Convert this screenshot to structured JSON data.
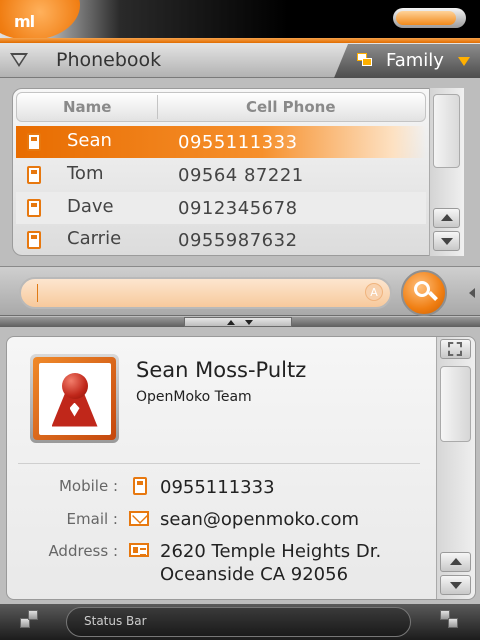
{
  "app": {
    "logo_text": "ml",
    "title": "Phonebook",
    "battery_level": 0.9
  },
  "header": {
    "group_label": "Family"
  },
  "list": {
    "columns": [
      "Name",
      "Cell Phone"
    ],
    "rows": [
      {
        "name": "Sean",
        "phone": "0955111333",
        "selected": true
      },
      {
        "name": "Tom",
        "phone": "09564 87221",
        "selected": false
      },
      {
        "name": "Dave",
        "phone": "0912345678",
        "selected": false
      },
      {
        "name": "Carrie",
        "phone": "0955987632",
        "selected": false
      }
    ]
  },
  "search": {
    "value": "",
    "keyboard_icon_text": "A"
  },
  "detail": {
    "name": "Sean Moss-Pultz",
    "organization": "OpenMoko Team",
    "fields": [
      {
        "label": "Mobile :",
        "icon": "phone-icon",
        "value": "0955111333"
      },
      {
        "label": "Email :",
        "icon": "envelope-icon",
        "value": "sean@openmoko.com"
      },
      {
        "label": "Address :",
        "icon": "address-card-icon",
        "value_line1": "2620 Temple Heights Dr.",
        "value_line2": "Oceanside CA 92056"
      }
    ]
  },
  "statusbar": {
    "text": "Status Bar"
  },
  "colors": {
    "accent": "#f07e12",
    "selected_row": "#e86c00",
    "panel_bg": "#f6f6f6",
    "topbar_bg": "#000000"
  }
}
